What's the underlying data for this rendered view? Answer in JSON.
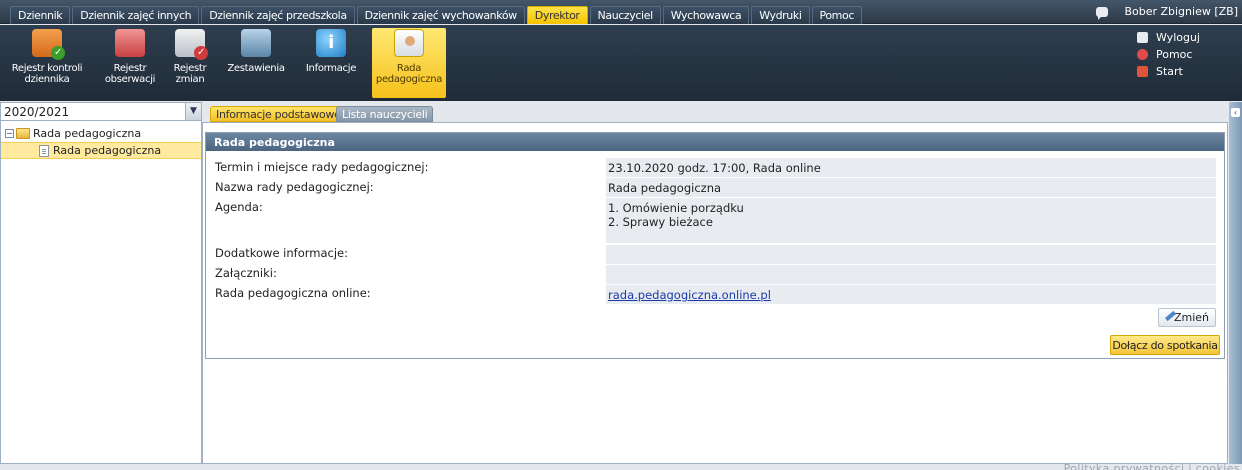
{
  "menu": {
    "tabs": [
      "Dziennik",
      "Dziennik zajęć innych",
      "Dziennik zajęć przedszkola",
      "Dziennik zajęć wychowanków",
      "Dyrektor",
      "Nauczyciel",
      "Wychowawca",
      "Wydruki",
      "Pomoc"
    ],
    "active_tab": "Dyrektor",
    "user": "Bober Zbigniew [ZB]"
  },
  "toolbar": {
    "rejestr_kontroli": [
      "Rejestr kontroli",
      "dziennika"
    ],
    "rejestr_obserwacji": [
      "Rejestr",
      "obserwacji"
    ],
    "rejestr_zmian": [
      "Rejestr",
      "zmian"
    ],
    "zestawienia": "Zestawienia",
    "informacje": "Informacje",
    "rada": [
      "Rada",
      "pedagogiczna"
    ]
  },
  "rightlinks": {
    "wyloguj": "Wyloguj",
    "pomoc": "Pomoc",
    "start": "Start"
  },
  "sidebar": {
    "year": "2020/2021",
    "tree_root": "Rada pedagogiczna",
    "tree_child": "Rada pedagogiczna"
  },
  "tabs": {
    "info": "Informacje podstawowe",
    "lista": "Lista nauczycieli"
  },
  "panel": {
    "title": "Rada pedagogiczna",
    "labels": {
      "termin": "Termin i miejsce rady pedagogicznej:",
      "nazwa": "Nazwa rady pedagogicznej:",
      "agenda": "Agenda:",
      "dodatkowe": "Dodatkowe informacje:",
      "zalaczniki": "Załączniki:",
      "online": "Rada pedagogiczna online:"
    },
    "values": {
      "termin": "23.10.2020 godz. 17:00, Rada online",
      "nazwa": "Rada pedagogiczna",
      "agenda_1": "1. Omówienie porządku",
      "agenda_2": "2. Sprawy bieżace",
      "dodatkowe": "",
      "zalaczniki": "",
      "online": "rada.pedagogiczna.online.pl"
    },
    "btn_zmien": "Zmień",
    "btn_dolacz": "Dołącz do spotkania"
  },
  "footer": "Polityka prywatności i cookies"
}
